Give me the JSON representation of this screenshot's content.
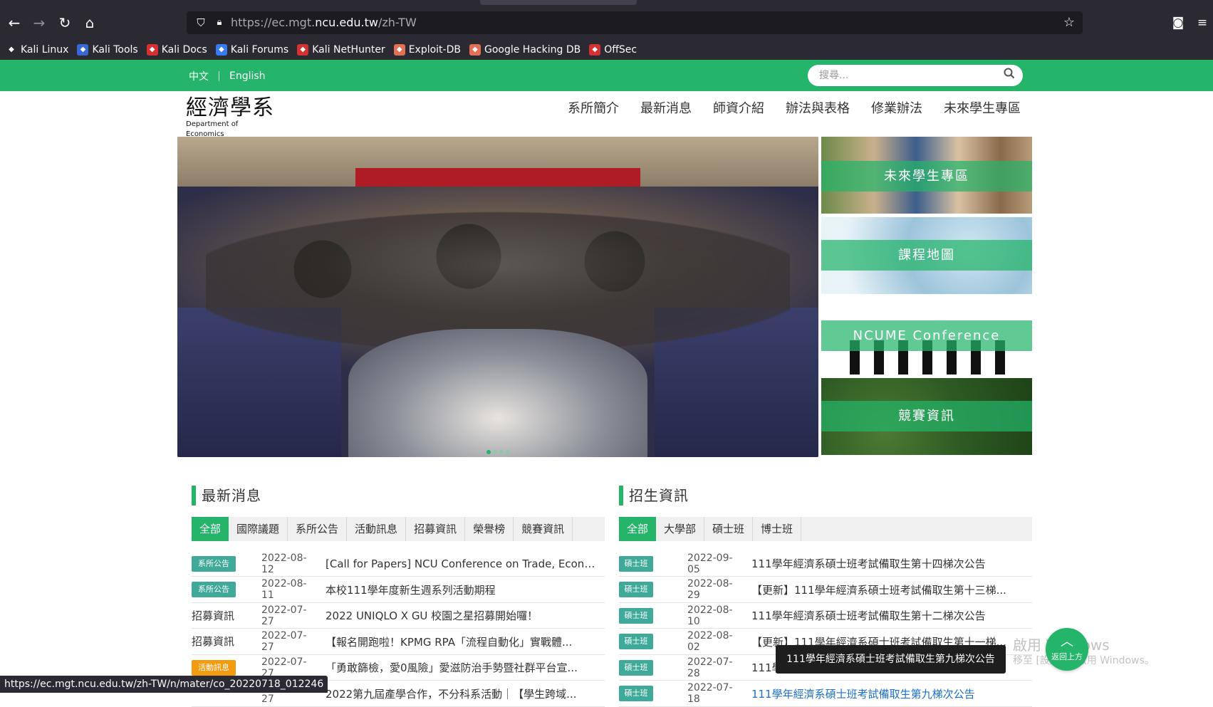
{
  "browser": {
    "url_prefix": "https://ec.mgt.",
    "url_domain": "ncu.edu.tw",
    "url_suffix": "/zh-TW",
    "status_url": "https://ec.mgt.ncu.edu.tw/zh-TW/n/mater/co_20220718_012246",
    "bookmarks": [
      {
        "label": "Kali Linux",
        "icon": "kali-dragon-icon",
        "color": "#2b2a33"
      },
      {
        "label": "Kali Tools",
        "icon": "kali-tools-icon",
        "color": "#3867d6"
      },
      {
        "label": "Kali Docs",
        "icon": "kali-docs-icon",
        "color": "#d63031"
      },
      {
        "label": "Kali Forums",
        "icon": "kali-forums-icon",
        "color": "#367bf0"
      },
      {
        "label": "Kali NetHunter",
        "icon": "nethunter-icon",
        "color": "#d63031"
      },
      {
        "label": "Exploit-DB",
        "icon": "exploit-db-icon",
        "color": "#e17055"
      },
      {
        "label": "Google Hacking DB",
        "icon": "ghdb-icon",
        "color": "#e17055"
      },
      {
        "label": "OffSec",
        "icon": "offsec-icon",
        "color": "#d63031"
      }
    ]
  },
  "site": {
    "accent": "#24b46a",
    "lang_zh": "中文",
    "lang_en": "English",
    "search_placeholder": "搜尋...",
    "logo_zh": "經濟學系",
    "logo_en": "Department of Economics",
    "nav": [
      "系所簡介",
      "最新消息",
      "師資介紹",
      "辦法與表格",
      "修業辦法",
      "未來學生專區"
    ],
    "tiles": [
      "未來學生專區",
      "課程地圖",
      "NCUME Conference",
      "競賽資訊"
    ],
    "carousel_dots": 4
  },
  "news": {
    "title": "最新消息",
    "tabs": [
      "全部",
      "國際議題",
      "系所公告",
      "活動訊息",
      "招募資訊",
      "榮譽榜",
      "競賽資訊"
    ],
    "rows": [
      {
        "tag": "系所公告",
        "tag_style": "badge",
        "tag_color": "#3fa99a",
        "date": "2022-08-12",
        "title": "[Call for Papers] NCU Conference on Trade, Econo..."
      },
      {
        "tag": "系所公告",
        "tag_style": "badge",
        "tag_color": "#3fa99a",
        "date": "2022-08-11",
        "title": "本校111學年度新生週系列活動期程"
      },
      {
        "tag": "招募資訊",
        "tag_style": "plain",
        "tag_color": "",
        "date": "2022-07-27",
        "title": "2022 UNIQLO X GU 校園之星招募開始囉！"
      },
      {
        "tag": "招募資訊",
        "tag_style": "plain",
        "tag_color": "",
        "date": "2022-07-27",
        "title": "【報名開跑啦！KPMG RPA「流程自動化」實戰體..."
      },
      {
        "tag": "活動訊息",
        "tag_style": "badge",
        "tag_color": "#f39c12",
        "date": "2022-07-27",
        "title": "「勇敢篩檢，愛0風險」愛滋防治手勢暨社群平台宣..."
      },
      {
        "tag": "",
        "tag_style": "plain",
        "tag_color": "",
        "date": "2022-07-27",
        "title": "2022第九屆產學合作，不分科系活動｜【學生跨域..."
      }
    ]
  },
  "admissions": {
    "title": "招生資訊",
    "tabs": [
      "全部",
      "大學部",
      "碩士班",
      "博士班"
    ],
    "rows": [
      {
        "tag": "碩士班",
        "date": "2022-09-05",
        "title": "111學年經濟系碩士班考試備取生第十四梯次公告",
        "link": false
      },
      {
        "tag": "碩士班",
        "date": "2022-08-29",
        "title": "【更新】111學年經濟系碩士班考試備取生第十三梯...",
        "link": false
      },
      {
        "tag": "碩士班",
        "date": "2022-08-10",
        "title": "111學年經濟系碩士班考試備取生第十二梯次公告",
        "link": false
      },
      {
        "tag": "碩士班",
        "date": "2022-08-02",
        "title": "【更新】111學年經濟系碩士班考試備取生第十一梯...",
        "link": false
      },
      {
        "tag": "碩士班",
        "date": "2022-07-28",
        "title": "111學年經濟系碩士班考試備取生第十梯次公告",
        "link": false
      },
      {
        "tag": "碩士班",
        "date": "2022-07-18",
        "title": "111學年經濟系碩士班考試備取生第九梯次公告",
        "link": true
      }
    ]
  },
  "tooltip": "111學年經濟系碩士班考試備取生第九梯次公告",
  "backtop_label": "返回上方",
  "watermark": {
    "line1": "啟用 Windows",
    "line2": "移至 [設定] 以啟用 Windows。"
  }
}
